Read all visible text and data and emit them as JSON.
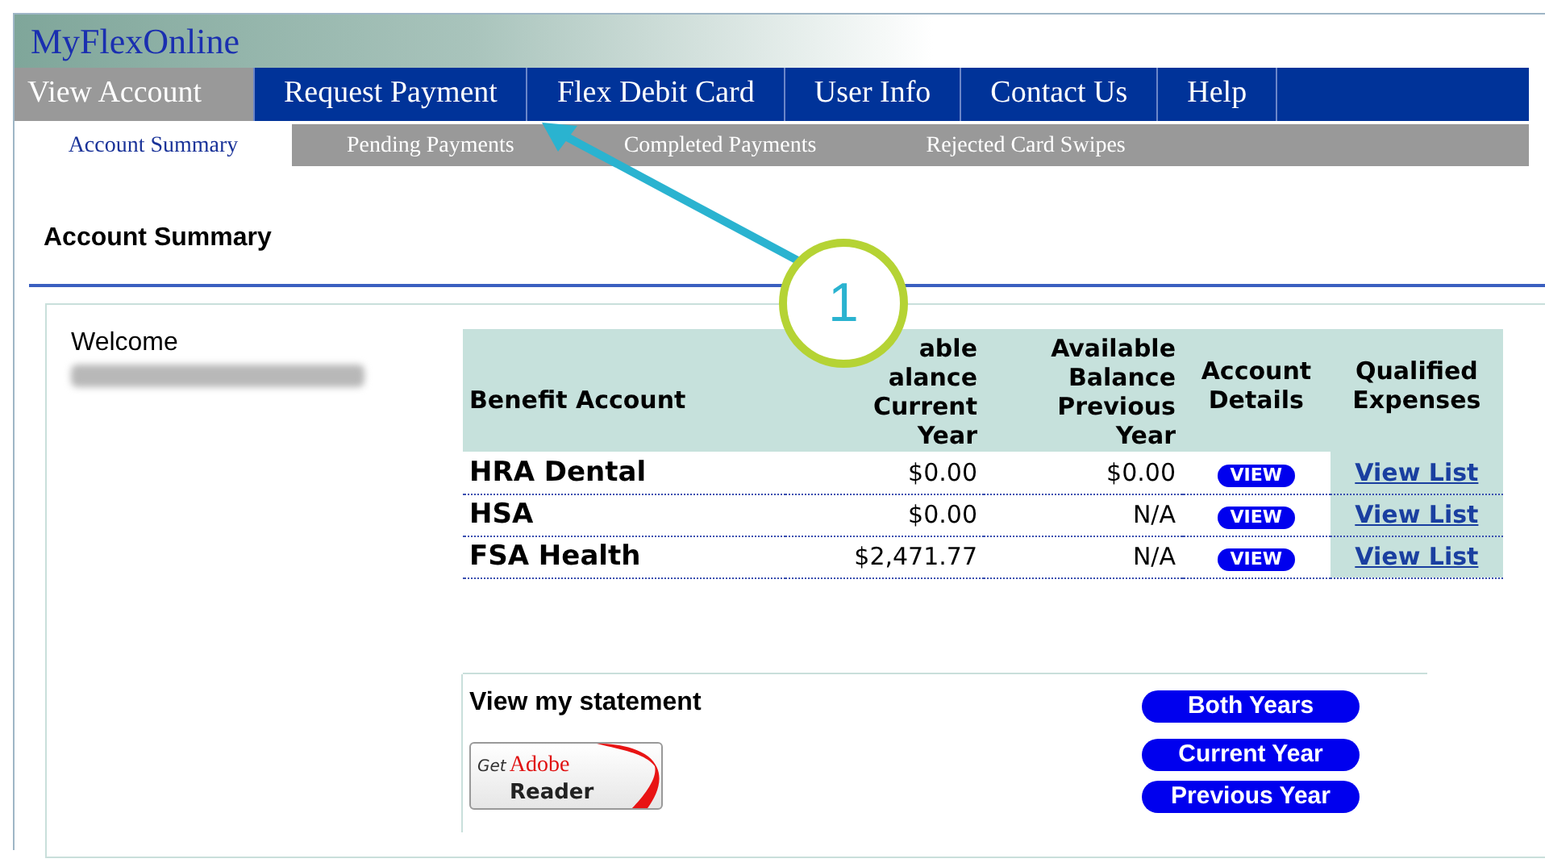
{
  "site_title": "MyFlexOnline",
  "tabs": [
    {
      "label": "View Account",
      "selected": true
    },
    {
      "label": "Request Payment",
      "selected": false
    },
    {
      "label": "Flex Debit Card",
      "selected": false
    },
    {
      "label": "User Info",
      "selected": false
    },
    {
      "label": "Contact Us",
      "selected": false
    },
    {
      "label": "Help",
      "selected": false
    }
  ],
  "subtabs": [
    {
      "label": "Account Summary",
      "selected": true
    },
    {
      "label": "Pending Payments",
      "selected": false
    },
    {
      "label": "Completed Payments",
      "selected": false
    },
    {
      "label": "Rejected Card Swipes",
      "selected": false
    }
  ],
  "page_heading": "Account Summary",
  "welcome": "Welcome",
  "table": {
    "columns": [
      [
        "Benefit Account"
      ],
      [
        "able",
        "alance",
        "Current",
        "Year"
      ],
      [
        "Available",
        "Balance",
        "Previous",
        "Year"
      ],
      [
        "Account",
        "Details"
      ],
      [
        "Qualified",
        "Expenses"
      ]
    ],
    "rows": [
      {
        "account": "HRA Dental",
        "current": "$0.00",
        "previous": "$0.00",
        "details": "VIEW",
        "expenses": "View List"
      },
      {
        "account": "HSA",
        "current": "$0.00",
        "previous": "N/A",
        "details": "VIEW",
        "expenses": "View List"
      },
      {
        "account": "FSA Health",
        "current": "$2,471.77",
        "previous": "N/A",
        "details": "VIEW",
        "expenses": "View List"
      }
    ]
  },
  "statement": {
    "label": "View my statement",
    "buttons": [
      "Both Years",
      "Current Year",
      "Previous Year"
    ]
  },
  "adobe_badge": {
    "get": "Get",
    "brand": "Adobe",
    "product": "Reader"
  },
  "callout": {
    "number": "1"
  }
}
